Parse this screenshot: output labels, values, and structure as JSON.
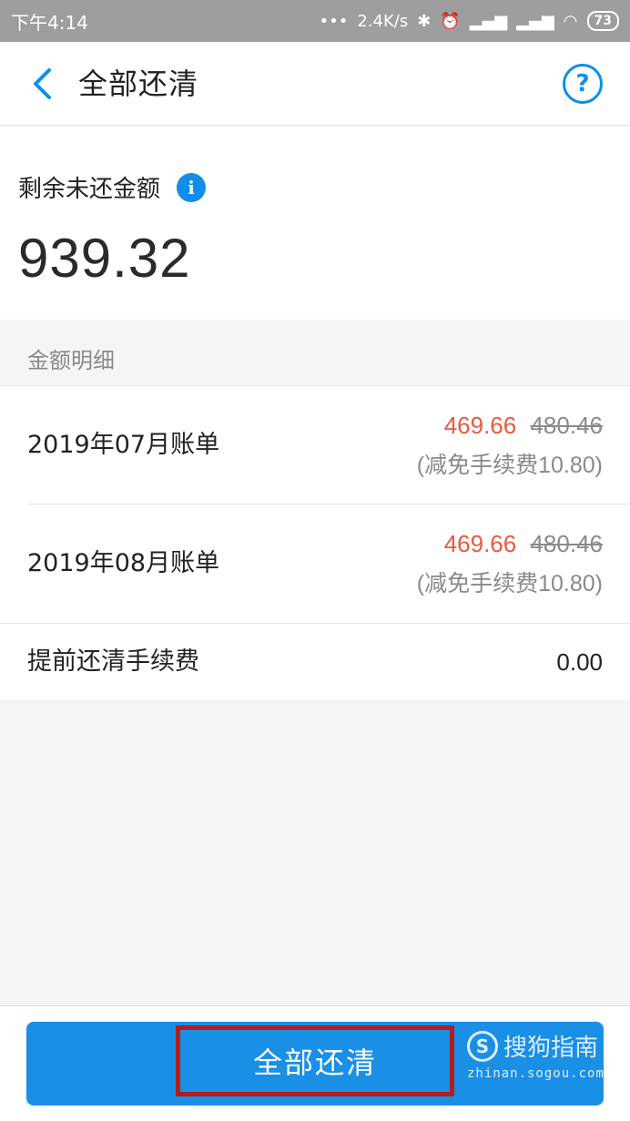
{
  "status_bar": {
    "time": "下午4:14",
    "dots": "•••",
    "speed": "2.4K/s",
    "battery": "73"
  },
  "header": {
    "title": "全部还清",
    "help_glyph": "?"
  },
  "summary": {
    "label": "剩余未还金额",
    "info_glyph": "i",
    "amount": "939.32"
  },
  "section": {
    "label": "金额明细"
  },
  "bills": [
    {
      "name": "2019年07月账单",
      "amount": "469.66",
      "original": "480.46",
      "waiver": "(减免手续费10.80)"
    },
    {
      "name": "2019年08月账单",
      "amount": "469.66",
      "original": "480.46",
      "waiver": "(减免手续费10.80)"
    }
  ],
  "fee": {
    "label": "提前还清手续费",
    "value": "0.00"
  },
  "bottom": {
    "pay_label": "全部还清",
    "watermark_text": "搜狗指南",
    "watermark_url": "zhinan.sogou.com"
  },
  "colors": {
    "accent": "#108ee9",
    "discount": "#e85a3a",
    "highlight": "#b71c1c"
  }
}
